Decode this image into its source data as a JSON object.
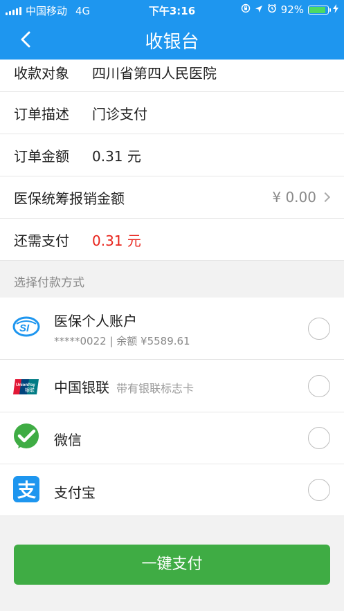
{
  "status": {
    "carrier": "中国移动",
    "network": "4G",
    "time": "下午3:16",
    "battery": "92%"
  },
  "nav": {
    "title": "收银台"
  },
  "order": [
    {
      "label": "收款对象",
      "value": "四川省第四人民医院"
    },
    {
      "label": "订单描述",
      "value": "门诊支付"
    },
    {
      "label": "订单金额",
      "value": "0.31 元"
    },
    {
      "label": "医保统筹报销金额",
      "value": "¥ 0.00"
    },
    {
      "label": "还需支付",
      "value": "0.31 元"
    }
  ],
  "payment": {
    "section_title": "选择付款方式",
    "methods": [
      {
        "name": "医保个人账户",
        "sub": "*****0022 | 余额 ¥5589.61",
        "icon": "si-medical-insurance-icon"
      },
      {
        "name": "中国银联",
        "note": "带有银联标志卡",
        "icon": "unionpay-icon"
      },
      {
        "name": "微信",
        "icon": "wechat-icon"
      },
      {
        "name": "支付宝",
        "icon": "alipay-icon"
      }
    ]
  },
  "actions": {
    "pay_label": "一键支付"
  },
  "colors": {
    "primary": "#1e96ef",
    "pay_button": "#3fac44",
    "due_amount": "#e8231b"
  }
}
